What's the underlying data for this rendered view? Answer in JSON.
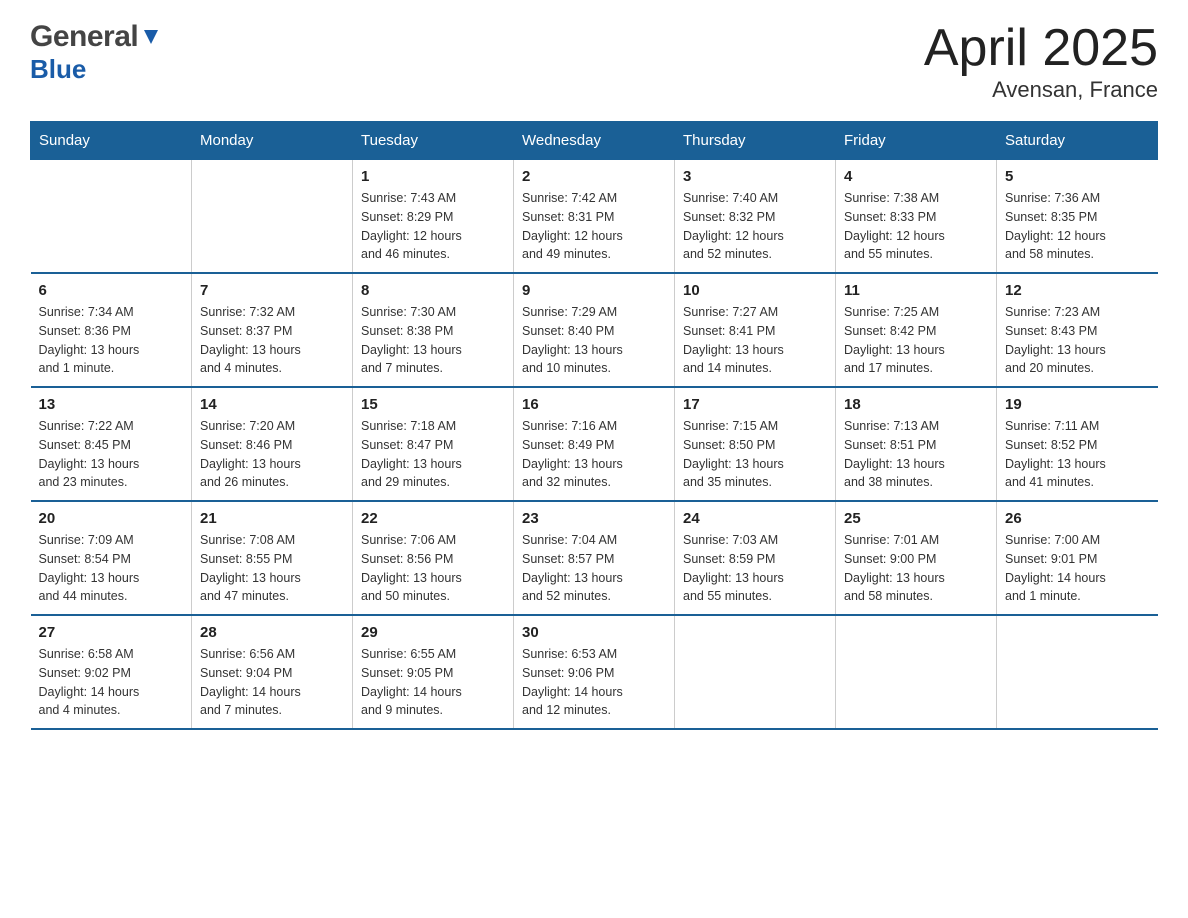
{
  "header": {
    "title": "April 2025",
    "subtitle": "Avensan, France",
    "logo_general": "General",
    "logo_blue": "Blue"
  },
  "days_of_week": [
    "Sunday",
    "Monday",
    "Tuesday",
    "Wednesday",
    "Thursday",
    "Friday",
    "Saturday"
  ],
  "weeks": [
    [
      {
        "day": "",
        "info": ""
      },
      {
        "day": "",
        "info": ""
      },
      {
        "day": "1",
        "info": "Sunrise: 7:43 AM\nSunset: 8:29 PM\nDaylight: 12 hours\nand 46 minutes."
      },
      {
        "day": "2",
        "info": "Sunrise: 7:42 AM\nSunset: 8:31 PM\nDaylight: 12 hours\nand 49 minutes."
      },
      {
        "day": "3",
        "info": "Sunrise: 7:40 AM\nSunset: 8:32 PM\nDaylight: 12 hours\nand 52 minutes."
      },
      {
        "day": "4",
        "info": "Sunrise: 7:38 AM\nSunset: 8:33 PM\nDaylight: 12 hours\nand 55 minutes."
      },
      {
        "day": "5",
        "info": "Sunrise: 7:36 AM\nSunset: 8:35 PM\nDaylight: 12 hours\nand 58 minutes."
      }
    ],
    [
      {
        "day": "6",
        "info": "Sunrise: 7:34 AM\nSunset: 8:36 PM\nDaylight: 13 hours\nand 1 minute."
      },
      {
        "day": "7",
        "info": "Sunrise: 7:32 AM\nSunset: 8:37 PM\nDaylight: 13 hours\nand 4 minutes."
      },
      {
        "day": "8",
        "info": "Sunrise: 7:30 AM\nSunset: 8:38 PM\nDaylight: 13 hours\nand 7 minutes."
      },
      {
        "day": "9",
        "info": "Sunrise: 7:29 AM\nSunset: 8:40 PM\nDaylight: 13 hours\nand 10 minutes."
      },
      {
        "day": "10",
        "info": "Sunrise: 7:27 AM\nSunset: 8:41 PM\nDaylight: 13 hours\nand 14 minutes."
      },
      {
        "day": "11",
        "info": "Sunrise: 7:25 AM\nSunset: 8:42 PM\nDaylight: 13 hours\nand 17 minutes."
      },
      {
        "day": "12",
        "info": "Sunrise: 7:23 AM\nSunset: 8:43 PM\nDaylight: 13 hours\nand 20 minutes."
      }
    ],
    [
      {
        "day": "13",
        "info": "Sunrise: 7:22 AM\nSunset: 8:45 PM\nDaylight: 13 hours\nand 23 minutes."
      },
      {
        "day": "14",
        "info": "Sunrise: 7:20 AM\nSunset: 8:46 PM\nDaylight: 13 hours\nand 26 minutes."
      },
      {
        "day": "15",
        "info": "Sunrise: 7:18 AM\nSunset: 8:47 PM\nDaylight: 13 hours\nand 29 minutes."
      },
      {
        "day": "16",
        "info": "Sunrise: 7:16 AM\nSunset: 8:49 PM\nDaylight: 13 hours\nand 32 minutes."
      },
      {
        "day": "17",
        "info": "Sunrise: 7:15 AM\nSunset: 8:50 PM\nDaylight: 13 hours\nand 35 minutes."
      },
      {
        "day": "18",
        "info": "Sunrise: 7:13 AM\nSunset: 8:51 PM\nDaylight: 13 hours\nand 38 minutes."
      },
      {
        "day": "19",
        "info": "Sunrise: 7:11 AM\nSunset: 8:52 PM\nDaylight: 13 hours\nand 41 minutes."
      }
    ],
    [
      {
        "day": "20",
        "info": "Sunrise: 7:09 AM\nSunset: 8:54 PM\nDaylight: 13 hours\nand 44 minutes."
      },
      {
        "day": "21",
        "info": "Sunrise: 7:08 AM\nSunset: 8:55 PM\nDaylight: 13 hours\nand 47 minutes."
      },
      {
        "day": "22",
        "info": "Sunrise: 7:06 AM\nSunset: 8:56 PM\nDaylight: 13 hours\nand 50 minutes."
      },
      {
        "day": "23",
        "info": "Sunrise: 7:04 AM\nSunset: 8:57 PM\nDaylight: 13 hours\nand 52 minutes."
      },
      {
        "day": "24",
        "info": "Sunrise: 7:03 AM\nSunset: 8:59 PM\nDaylight: 13 hours\nand 55 minutes."
      },
      {
        "day": "25",
        "info": "Sunrise: 7:01 AM\nSunset: 9:00 PM\nDaylight: 13 hours\nand 58 minutes."
      },
      {
        "day": "26",
        "info": "Sunrise: 7:00 AM\nSunset: 9:01 PM\nDaylight: 14 hours\nand 1 minute."
      }
    ],
    [
      {
        "day": "27",
        "info": "Sunrise: 6:58 AM\nSunset: 9:02 PM\nDaylight: 14 hours\nand 4 minutes."
      },
      {
        "day": "28",
        "info": "Sunrise: 6:56 AM\nSunset: 9:04 PM\nDaylight: 14 hours\nand 7 minutes."
      },
      {
        "day": "29",
        "info": "Sunrise: 6:55 AM\nSunset: 9:05 PM\nDaylight: 14 hours\nand 9 minutes."
      },
      {
        "day": "30",
        "info": "Sunrise: 6:53 AM\nSunset: 9:06 PM\nDaylight: 14 hours\nand 12 minutes."
      },
      {
        "day": "",
        "info": ""
      },
      {
        "day": "",
        "info": ""
      },
      {
        "day": "",
        "info": ""
      }
    ]
  ]
}
